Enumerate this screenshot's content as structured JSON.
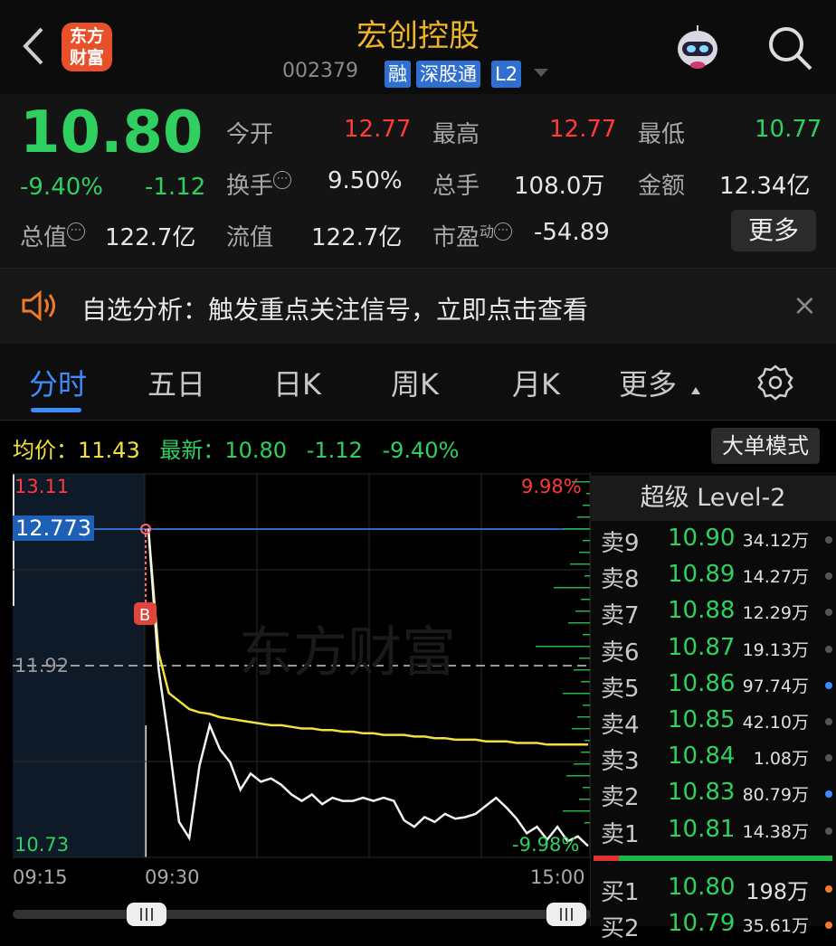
{
  "header": {
    "back_icon": "chevron-left-icon",
    "logo_text": "东方财富",
    "title": "宏创控股",
    "code": "002379",
    "tags": [
      "融",
      "深股通",
      "L2"
    ]
  },
  "quote": {
    "price": "10.80",
    "change_pct": "-9.40%",
    "change": "-1.12",
    "open_label": "今开",
    "open": "12.77",
    "high_label": "最高",
    "high": "12.77",
    "low_label": "最低",
    "low": "10.77",
    "turnover_label": "换手",
    "turnover": "9.50%",
    "volume_label": "总手",
    "volume": "108.0万",
    "amount_label": "金额",
    "amount": "12.34亿",
    "mcap_label": "总值",
    "mcap": "122.7亿",
    "float_label": "流值",
    "float": "122.7亿",
    "pe_label": "市盈",
    "pe_sup": "动",
    "pe": "-54.89",
    "more_button": "更多"
  },
  "banner": {
    "text": "自选分析：触发重点关注信号，立即点击查看",
    "close": "×"
  },
  "tabs": [
    "分时",
    "五日",
    "日K",
    "周K",
    "月K",
    "更多"
  ],
  "legend": {
    "avg_label": "均价：",
    "avg": "11.43",
    "latest_label": "最新：",
    "latest": "10.80",
    "change": "-1.12",
    "pct": "-9.40%",
    "mode_button": "大单模式"
  },
  "chart_data": {
    "type": "line",
    "y_labels": {
      "top": "13.11",
      "ref": "12.773",
      "mid": "11.92",
      "bottom": "10.73"
    },
    "pct_labels": {
      "top": "9.98%",
      "bottom": "-9.98%"
    },
    "x_labels": [
      "09:15",
      "09:30",
      "15:00"
    ],
    "marker": "B",
    "ylim": [
      10.73,
      13.11
    ],
    "series": [
      {
        "values": [
          12.77,
          11.9,
          11.45,
          10.95,
          10.85,
          11.3,
          11.55,
          11.4,
          11.32,
          11.15,
          11.25,
          11.2,
          11.22,
          11.18,
          11.12,
          11.08,
          11.12,
          11.06,
          11.1,
          11.08,
          11.08,
          11.1,
          11.08,
          11.1,
          11.08,
          10.96,
          10.92,
          10.98,
          10.95,
          11.0,
          10.97,
          10.98,
          11.0,
          11.05,
          11.1,
          11.04,
          10.97,
          10.88,
          10.92,
          10.84,
          10.92,
          10.83,
          10.86,
          10.8
        ]
      },
      {
        "values": [
          12.77,
          12.0,
          11.75,
          11.7,
          11.65,
          11.63,
          11.62,
          11.6,
          11.59,
          11.58,
          11.57,
          11.56,
          11.55,
          11.55,
          11.54,
          11.53,
          11.53,
          11.52,
          11.52,
          11.51,
          11.51,
          11.5,
          11.5,
          11.49,
          11.49,
          11.49,
          11.48,
          11.48,
          11.47,
          11.47,
          11.46,
          11.46,
          11.46,
          11.45,
          11.45,
          11.45,
          11.44,
          11.44,
          11.44,
          11.43,
          11.43,
          11.43,
          11.43,
          11.43
        ]
      }
    ]
  },
  "orderbook": {
    "title": "超级 Level-2",
    "sells": [
      {
        "k": "卖9",
        "p": "10.90",
        "v": "34.12万"
      },
      {
        "k": "卖8",
        "p": "10.89",
        "v": "14.27万"
      },
      {
        "k": "卖7",
        "p": "10.88",
        "v": "12.29万"
      },
      {
        "k": "卖6",
        "p": "10.87",
        "v": "19.13万"
      },
      {
        "k": "卖5",
        "p": "10.86",
        "v": "97.74万"
      },
      {
        "k": "卖4",
        "p": "10.85",
        "v": "42.10万"
      },
      {
        "k": "卖3",
        "p": "10.84",
        "v": "1.08万"
      },
      {
        "k": "卖2",
        "p": "10.83",
        "v": "80.79万"
      },
      {
        "k": "卖1",
        "p": "10.81",
        "v": "14.38万"
      }
    ],
    "buys": [
      {
        "k": "买1",
        "p": "10.80",
        "v": "198万"
      },
      {
        "k": "买2",
        "p": "10.79",
        "v": "35.61万"
      }
    ]
  },
  "colors": {
    "up": "#ff3a3a",
    "down": "#2fd060",
    "accent": "#3d8bff",
    "avg": "#f0e040"
  }
}
